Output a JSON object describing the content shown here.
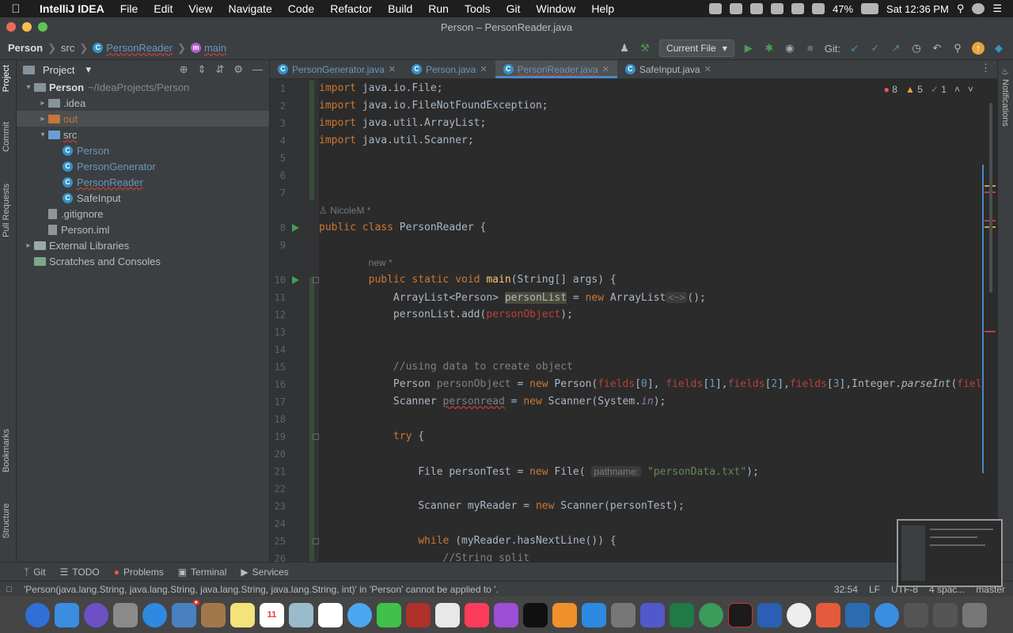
{
  "menubar": {
    "app": "IntelliJ IDEA",
    "items": [
      "File",
      "Edit",
      "View",
      "Navigate",
      "Code",
      "Refactor",
      "Build",
      "Run",
      "Tools",
      "Git",
      "Window",
      "Help"
    ],
    "battery": "47%",
    "clock": "Sat 12:36 PM"
  },
  "window": {
    "title": "Person – PersonReader.java"
  },
  "navbar": {
    "crumbs": [
      "Person",
      "src",
      "PersonReader",
      "main"
    ],
    "run_config": "Current File",
    "git_label": "Git:"
  },
  "left_strip": {
    "tabs": [
      "Project",
      "Commit",
      "Pull Requests",
      "Bookmarks",
      "Structure"
    ]
  },
  "right_strip": {
    "tabs": [
      "Notifications"
    ]
  },
  "project": {
    "title": "Project",
    "tree": [
      {
        "label": "Person",
        "suffix": "~/IdeaProjects/Person",
        "depth": 0,
        "arrow": "▾",
        "kind": "root"
      },
      {
        "label": ".idea",
        "depth": 1,
        "arrow": "▸",
        "kind": "folder"
      },
      {
        "label": "out",
        "depth": 1,
        "arrow": "▸",
        "kind": "folder-orange"
      },
      {
        "label": "src",
        "depth": 1,
        "arrow": "▾",
        "kind": "folder-blue"
      },
      {
        "label": "Person",
        "depth": 2,
        "arrow": "",
        "kind": "class"
      },
      {
        "label": "PersonGenerator",
        "depth": 2,
        "arrow": "",
        "kind": "class"
      },
      {
        "label": "PersonReader",
        "depth": 2,
        "arrow": "",
        "kind": "class-err"
      },
      {
        "label": "SafeInput",
        "depth": 2,
        "arrow": "",
        "kind": "class-plain"
      },
      {
        "label": ".gitignore",
        "depth": 1,
        "arrow": "",
        "kind": "file"
      },
      {
        "label": "Person.iml",
        "depth": 1,
        "arrow": "",
        "kind": "file"
      },
      {
        "label": "External Libraries",
        "depth": 0,
        "arrow": "▸",
        "kind": "lib"
      },
      {
        "label": "Scratches and Consoles",
        "depth": 0,
        "arrow": "",
        "kind": "scratch"
      }
    ]
  },
  "tabs": [
    {
      "label": "PersonGenerator.java",
      "active": false
    },
    {
      "label": "Person.java",
      "active": false
    },
    {
      "label": "PersonReader.java",
      "active": true
    },
    {
      "label": "SafeInput.java",
      "active": false
    }
  ],
  "inspections": {
    "errors": "8",
    "warnings": "5",
    "ok": "1"
  },
  "editor": {
    "author_hint": "NicoleM *",
    "new_hint": "new *",
    "param_hint": "pathname:"
  },
  "bottom_tools": [
    "Git",
    "TODO",
    "Problems",
    "Terminal",
    "Services"
  ],
  "status": {
    "message": "'Person(java.lang.String, java.lang.String, java.lang.String, java.lang.String, int)' in 'Person' cannot be applied to '.",
    "position": "32:54",
    "line_sep": "LF",
    "encoding": "UTF-8",
    "indent": "4 spac...",
    "branch": "master"
  },
  "colors": {
    "keyword": "#cc7832",
    "string": "#6a8759",
    "field": "#9876aa",
    "comment": "#808080",
    "accent": "#4a88c7"
  }
}
